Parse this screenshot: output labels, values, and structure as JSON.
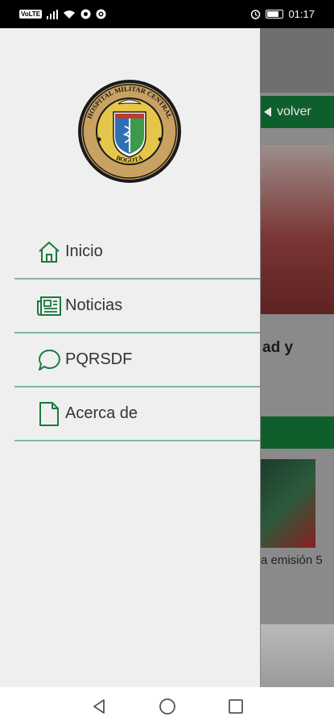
{
  "status_bar": {
    "sim_label": "VoLTE",
    "time": "01:17",
    "icons": [
      "signal-icon",
      "wifi-icon",
      "sync-icon",
      "settings-icon",
      "alarm-icon",
      "battery-icon"
    ]
  },
  "background_app": {
    "back_label": "volver",
    "headline_fragment": "ad y",
    "caption_fragment": "a emisión 5"
  },
  "logo": {
    "top_text": "HOSPITAL MILITAR CENTRAL",
    "bottom_text": "BOGOTÁ"
  },
  "menu": {
    "items": [
      {
        "label": "Inicio",
        "icon": "home-icon"
      },
      {
        "label": "Noticias",
        "icon": "newspaper-icon"
      },
      {
        "label": "PQRSDF",
        "icon": "chat-bubble-icon"
      },
      {
        "label": "Acerca de",
        "icon": "document-icon"
      }
    ]
  },
  "colors": {
    "accent_green": "#1a7a3e",
    "divider_green": "#7fb89a",
    "drawer_bg": "#efefef"
  }
}
